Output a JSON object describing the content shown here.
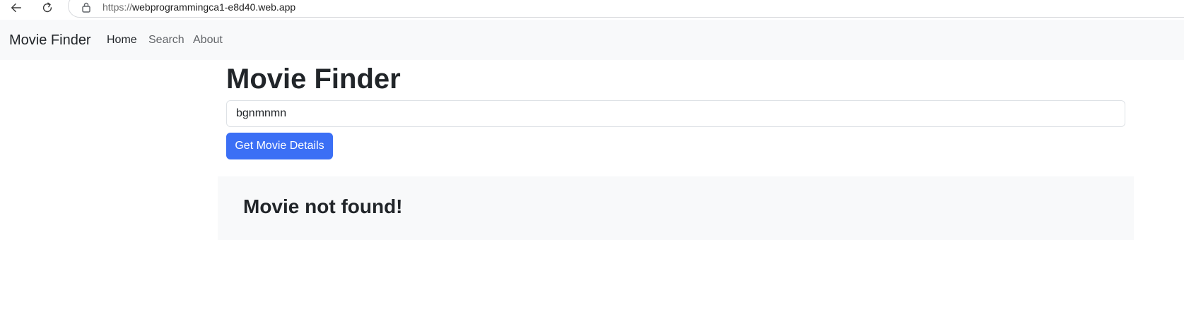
{
  "browser": {
    "url_prefix": "https://",
    "url_host": "webprogrammingca1-e8d40.web.app",
    "icons": [
      "back-arrow-icon",
      "reload-icon",
      "lock-icon"
    ]
  },
  "navbar": {
    "brand": "Movie Finder",
    "links": [
      {
        "label": "Home",
        "active": true
      },
      {
        "label": "Search",
        "active": false
      },
      {
        "label": "About",
        "active": false
      }
    ]
  },
  "main": {
    "title": "Movie Finder",
    "search_value": "bgnmnmn",
    "submit_label": "Get Movie Details",
    "result_message": "Movie not found!"
  },
  "colors": {
    "primary_button": "#3b6ff5",
    "navbar_bg": "#f8f9fa",
    "panel_bg": "#f8f9fa",
    "text": "#212529"
  }
}
